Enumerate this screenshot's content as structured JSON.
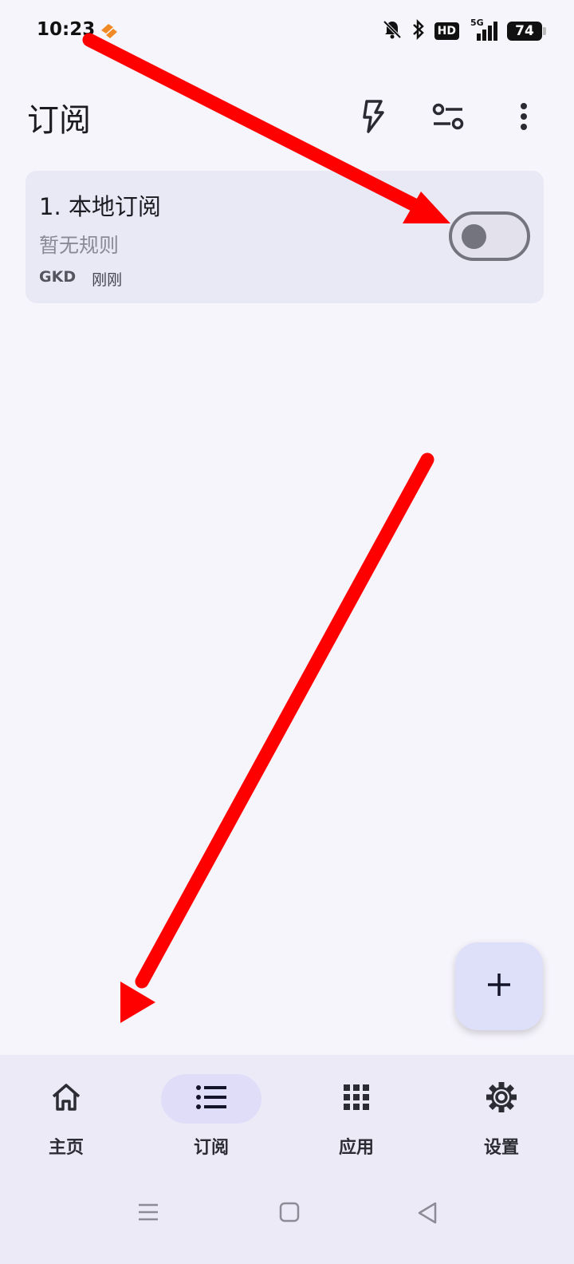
{
  "status_bar": {
    "time": "10:23",
    "hd": "HD",
    "network": "5G",
    "battery": "74",
    "icons": [
      "app-notification-icon",
      "mute-bell-icon",
      "bluetooth-icon",
      "hd-icon",
      "signal-5g-icon",
      "battery-icon"
    ]
  },
  "app_bar": {
    "title": "订阅",
    "actions": [
      "flash-icon",
      "filter-sliders-icon",
      "more-vert-icon"
    ]
  },
  "subscriptions": [
    {
      "name": "1. 本地订阅",
      "description": "暂无规则",
      "source": "GKD",
      "updated": "刚刚",
      "enabled": false
    }
  ],
  "fab": {
    "icon": "add-icon"
  },
  "bottom_nav": {
    "items": [
      {
        "label": "主页",
        "icon": "home-icon",
        "active": false
      },
      {
        "label": "订阅",
        "icon": "list-icon",
        "active": true
      },
      {
        "label": "应用",
        "icon": "grid-icon",
        "active": false
      },
      {
        "label": "设置",
        "icon": "gear-icon",
        "active": false
      }
    ]
  },
  "system_nav": [
    "menu-icon",
    "home-square-icon",
    "back-triangle-icon"
  ],
  "annotation_color": "#ff0000"
}
